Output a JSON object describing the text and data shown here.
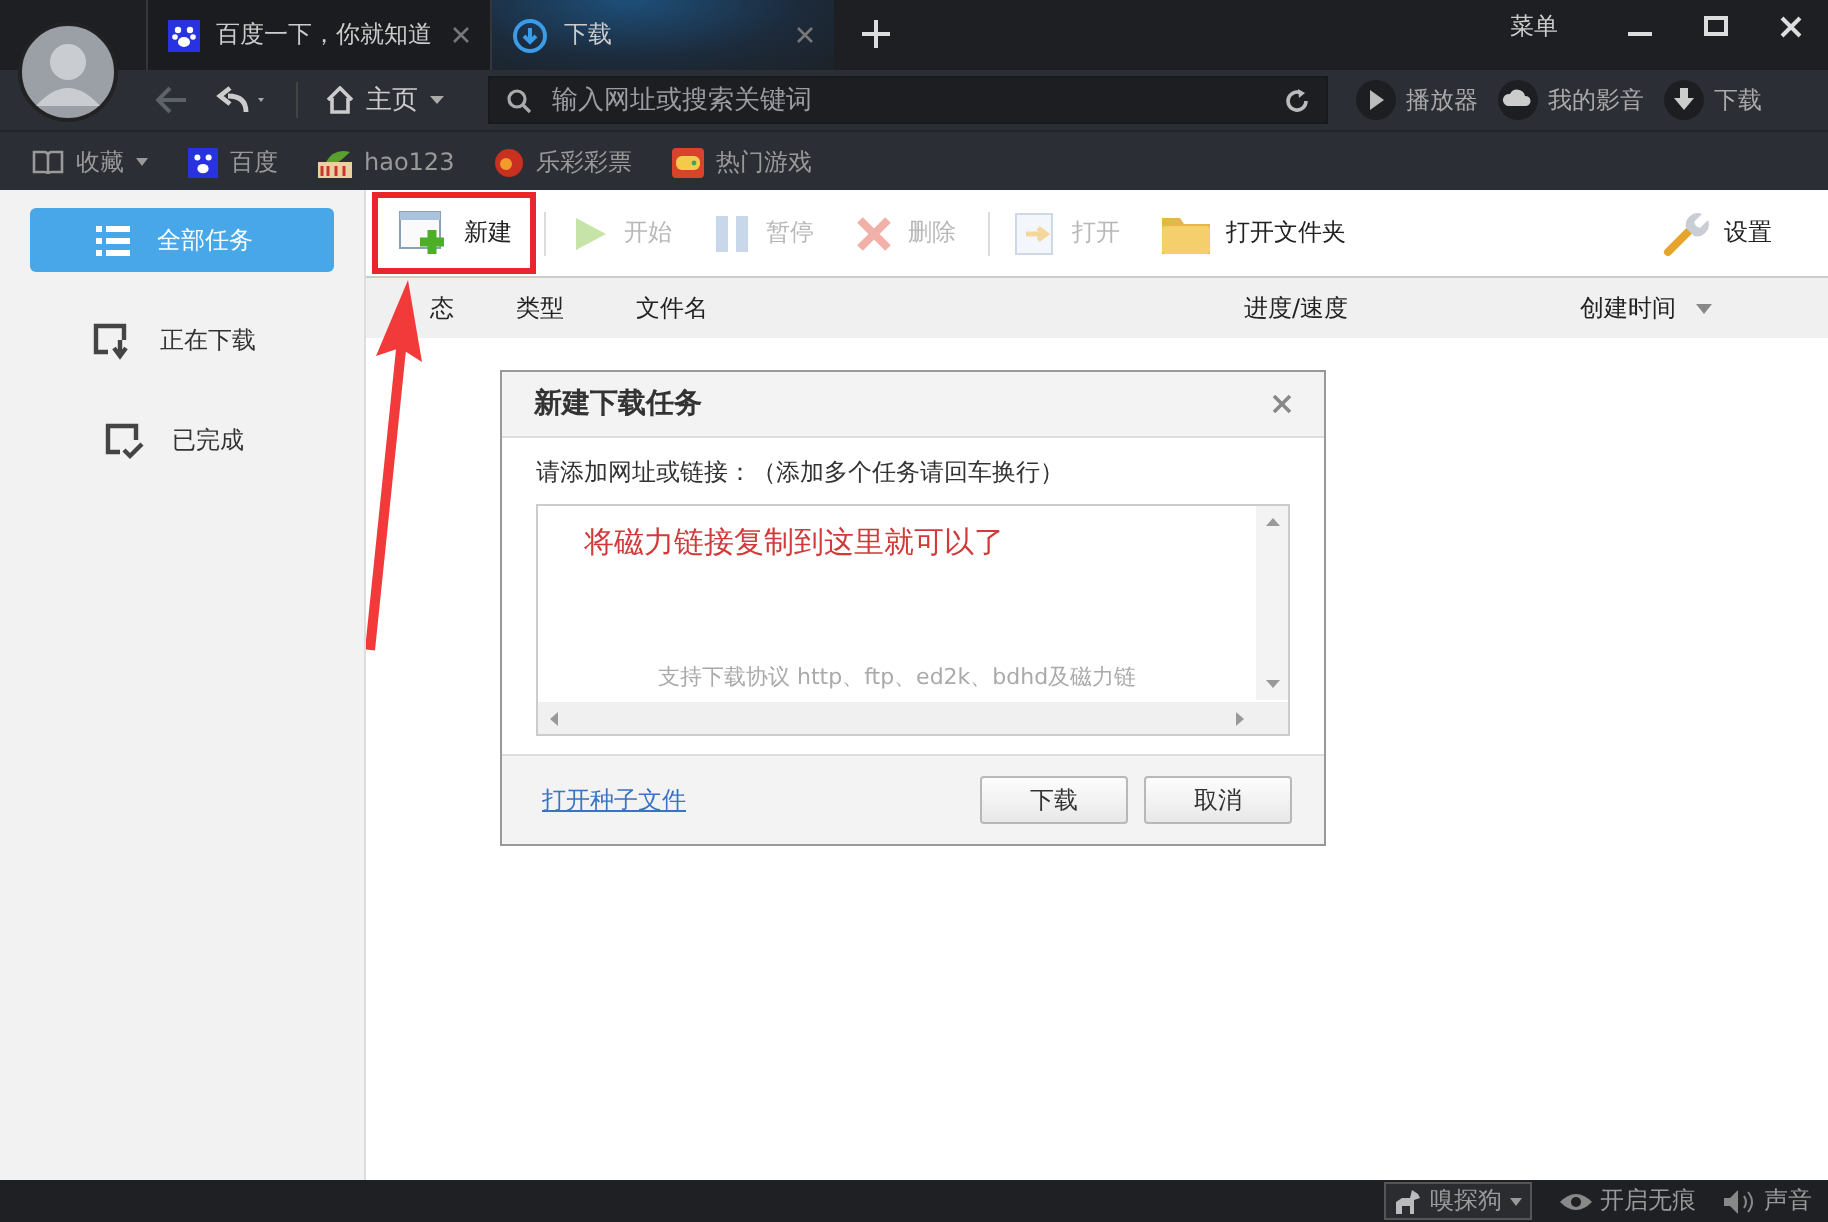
{
  "tabs": [
    {
      "label": "百度一下，你就知道",
      "selected": false
    },
    {
      "label": "下载",
      "selected": true
    }
  ],
  "window_controls": {
    "menu": "菜单"
  },
  "nav": {
    "home": "主页",
    "address_placeholder": "输入网址或搜索关键词",
    "links": [
      {
        "label": "播放器"
      },
      {
        "label": "我的影音"
      },
      {
        "label": "下载"
      }
    ]
  },
  "bookmarks": [
    {
      "label": "收藏"
    },
    {
      "label": "百度"
    },
    {
      "label": "hao123"
    },
    {
      "label": "乐彩彩票"
    },
    {
      "label": "热门游戏"
    }
  ],
  "sidebar": {
    "items": [
      {
        "label": "全部任务",
        "selected": true
      },
      {
        "label": "正在下载",
        "selected": false
      },
      {
        "label": "已完成",
        "selected": false
      }
    ]
  },
  "toolbar": {
    "items": [
      {
        "label": "新建",
        "disabled": false
      },
      {
        "label": "开始",
        "disabled": true
      },
      {
        "label": "暂停",
        "disabled": true
      },
      {
        "label": "删除",
        "disabled": true
      },
      {
        "label": "打开",
        "disabled": true
      },
      {
        "label": "打开文件夹",
        "disabled": false
      }
    ],
    "settings": "设置"
  },
  "table": {
    "columns": [
      "态",
      "类型",
      "文件名",
      "进度/速度",
      "创建时间"
    ]
  },
  "dialog": {
    "title": "新建下载任务",
    "prompt": "请添加网址或链接：（添加多个任务请回车换行）",
    "placeholder": "支持下载协议 http、ftp、ed2k、bdhd及磁力链",
    "link": "打开种子文件",
    "buttons": [
      "下载",
      "取消"
    ]
  },
  "annotation": {
    "text": "将磁力链接复制到这里就可以了"
  },
  "status_bar": [
    {
      "label": "嗅探狗"
    },
    {
      "label": "开启无痕"
    },
    {
      "label": "声音"
    }
  ]
}
